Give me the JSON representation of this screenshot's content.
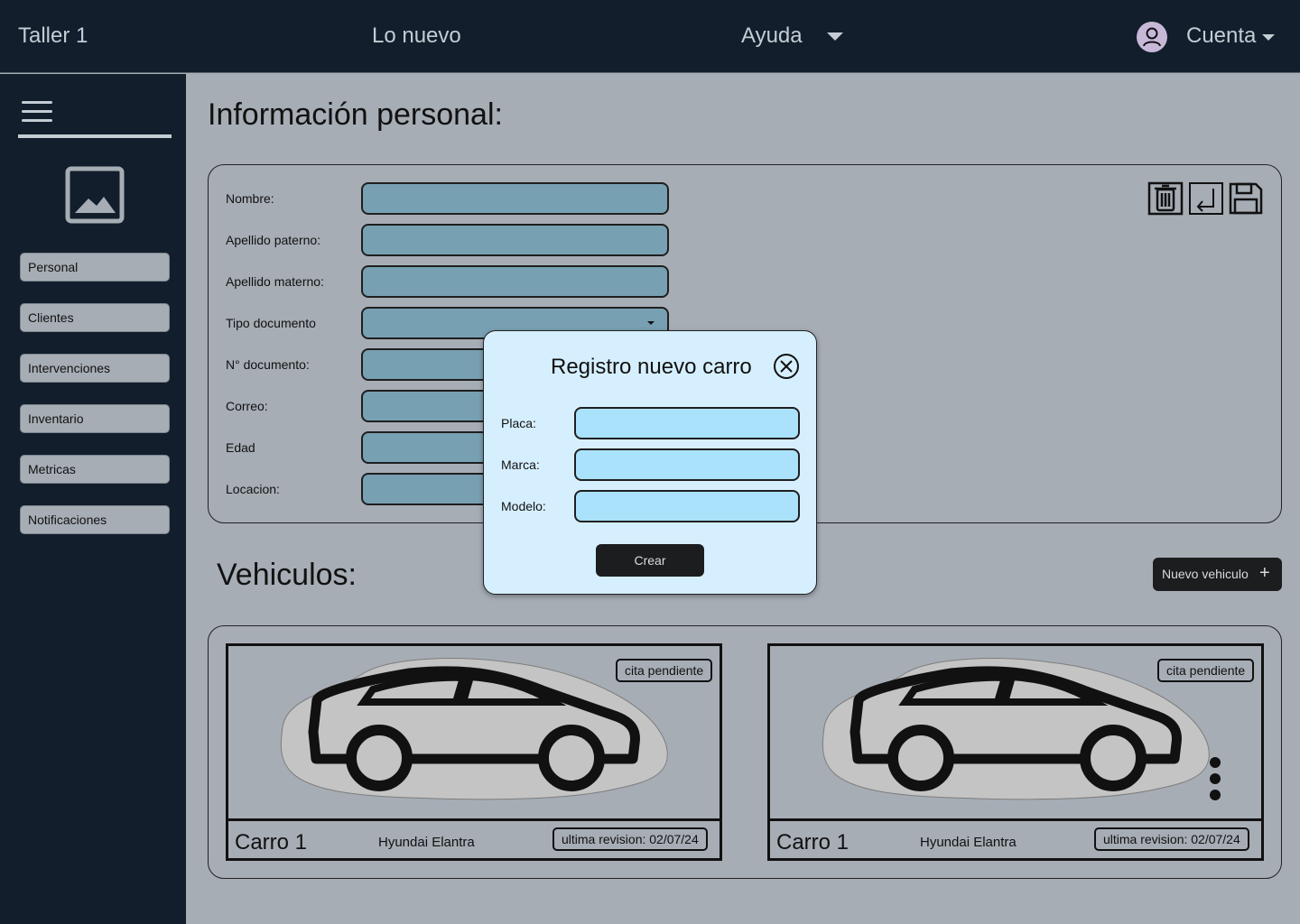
{
  "topbar": {
    "brand": "Taller 1",
    "new_link": "Lo nuevo",
    "help_label": "Ayuda",
    "account_label": "Cuenta",
    "avatar_icon": "user-avatar-icon"
  },
  "sidebar": {
    "menu_icon": "hamburger-menu-icon",
    "photo_icon": "image-placeholder-icon",
    "items": [
      {
        "label": "Personal"
      },
      {
        "label": "Clientes"
      },
      {
        "label": "Intervenciones"
      },
      {
        "label": "Inventario"
      },
      {
        "label": "Metricas"
      },
      {
        "label": "Notificaciones"
      }
    ]
  },
  "personal": {
    "title": "Información personal:",
    "fields": [
      {
        "label": "Nombre:",
        "value": ""
      },
      {
        "label": "Apellido paterno:",
        "value": ""
      },
      {
        "label": "Apellido materno:",
        "value": ""
      },
      {
        "label": "Tipo documento",
        "value": ""
      },
      {
        "label": "N° documento:",
        "value": ""
      },
      {
        "label": "Correo:",
        "value": ""
      },
      {
        "label": "Edad",
        "value": ""
      },
      {
        "label": "Locacion:",
        "value": ""
      }
    ],
    "tools": [
      "trash-icon",
      "import-icon",
      "save-icon"
    ]
  },
  "vehicles": {
    "title": "Vehiculos:",
    "new_button": "Nuevo vehiculo",
    "new_button_icon": "+",
    "cards": [
      {
        "name": "Carro 1",
        "model": "Hyundai Elantra",
        "status": "cita pendiente",
        "revision": "ultima revision: 02/07/24"
      },
      {
        "name": "Carro 1",
        "model": "Hyundai Elantra",
        "status": "cita pendiente",
        "revision": "ultima revision: 02/07/24"
      }
    ]
  },
  "modal": {
    "title": "Registro nuevo carro",
    "close_icon": "close-circle-icon",
    "fields": [
      {
        "label": "Placa:",
        "value": ""
      },
      {
        "label": "Marca:",
        "value": ""
      },
      {
        "label": "Modelo:",
        "value": ""
      }
    ],
    "submit": "Crear"
  },
  "colors": {
    "dark": "#121e2c",
    "background": "#a6adb5",
    "field": "#78a0b3",
    "modal": "#d6efff",
    "modal_field": "#abe2fb"
  }
}
